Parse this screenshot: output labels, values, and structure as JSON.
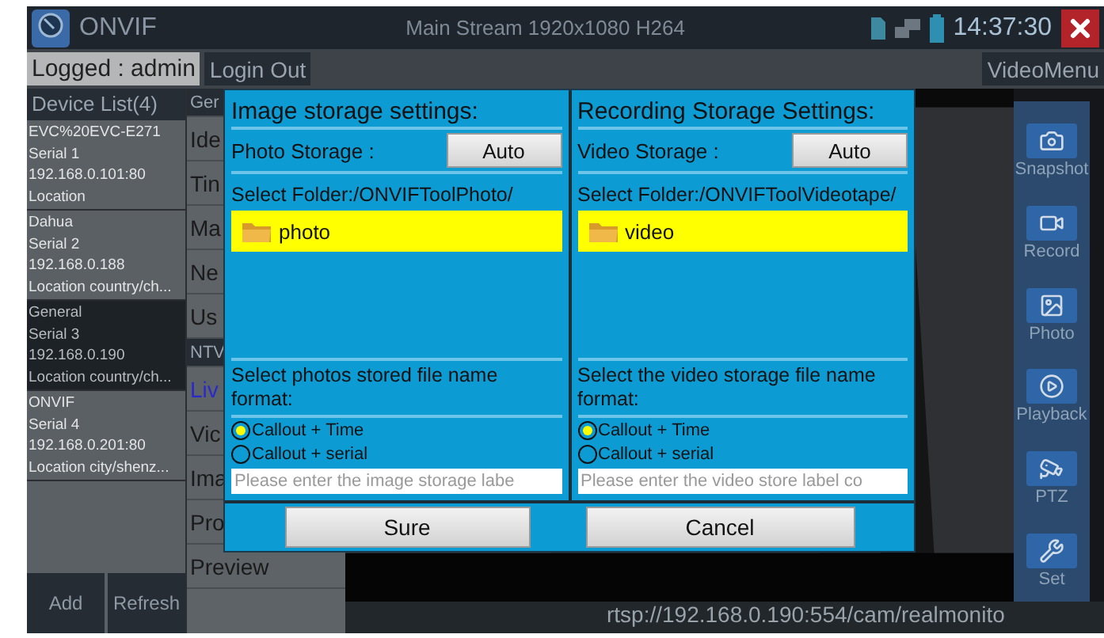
{
  "app": {
    "title": "ONVIF",
    "stream_info": "Main Stream 1920x1080 H264",
    "time": "14:37:30"
  },
  "session": {
    "user_label": "Logged : admin",
    "logout": "Login Out",
    "video_menu": "VideoMenu"
  },
  "device_list": {
    "title": "Device List(4)",
    "devices": [
      {
        "lines": [
          "EVC%20EVC-E271",
          "Serial 1",
          "192.168.0.101:80",
          "Location"
        ],
        "selected": false
      },
      {
        "lines": [
          "Dahua",
          "Serial 2",
          "192.168.0.188",
          "Location country/ch..."
        ],
        "selected": false
      },
      {
        "lines": [
          "General",
          "Serial 3",
          "192.168.0.190",
          "Location country/ch..."
        ],
        "selected": true
      },
      {
        "lines": [
          "ONVIF",
          "Serial 4",
          "192.168.0.201:80",
          "Location city/shenz..."
        ],
        "selected": false
      }
    ],
    "buttons": [
      "Add",
      "Refresh"
    ]
  },
  "menu": {
    "items": [
      {
        "label": "Ger",
        "kind": "section",
        "selected": false
      },
      {
        "label": "Ide",
        "kind": "item",
        "selected": false
      },
      {
        "label": "Tin",
        "kind": "item",
        "selected": false
      },
      {
        "label": "Ma",
        "kind": "item",
        "selected": false
      },
      {
        "label": "Ne",
        "kind": "item",
        "selected": false
      },
      {
        "label": "Us",
        "kind": "item",
        "selected": false
      },
      {
        "label": "NTV",
        "kind": "section",
        "selected": false
      },
      {
        "label": "Liv",
        "kind": "item",
        "selected": true
      },
      {
        "label": "Vic",
        "kind": "item",
        "selected": false
      },
      {
        "label": "Ima",
        "kind": "item",
        "selected": false
      },
      {
        "label": "Pro",
        "kind": "item",
        "selected": false
      },
      {
        "label": "Preview",
        "kind": "item",
        "selected": false
      }
    ]
  },
  "tools": [
    {
      "label": "Snapshot"
    },
    {
      "label": "Record"
    },
    {
      "label": "Photo"
    },
    {
      "label": "Playback"
    },
    {
      "label": "PTZ"
    },
    {
      "label": "Set"
    }
  ],
  "stream_url": "rtsp://192.168.0.190:554/cam/realmonito",
  "dialog": {
    "panels": [
      {
        "title": "Image storage settings:",
        "storage_label": "Photo Storage :",
        "storage_value": "Auto",
        "folder_label": "Select Folder:/ONVIFToolPhoto/",
        "folders": [
          {
            "name": "photo",
            "selected": true
          }
        ],
        "format_label": "Select photos stored file name format:",
        "options": [
          {
            "label": "Callout + Time",
            "selected": true
          },
          {
            "label": "Callout + serial",
            "selected": false
          }
        ],
        "placeholder": "Please enter the image storage labe"
      },
      {
        "title": "Recording Storage Settings:",
        "storage_label": "Video Storage :",
        "storage_value": "Auto",
        "folder_label": "Select Folder:/ONVIFToolVideotape/",
        "folders": [
          {
            "name": "video",
            "selected": true
          }
        ],
        "format_label": "Select the video storage file name format:",
        "options": [
          {
            "label": "Callout + Time",
            "selected": true
          },
          {
            "label": "Callout + serial",
            "selected": false
          }
        ],
        "placeholder": "Please enter the video store label co"
      }
    ],
    "buttons": [
      "Sure",
      "Cancel"
    ]
  }
}
